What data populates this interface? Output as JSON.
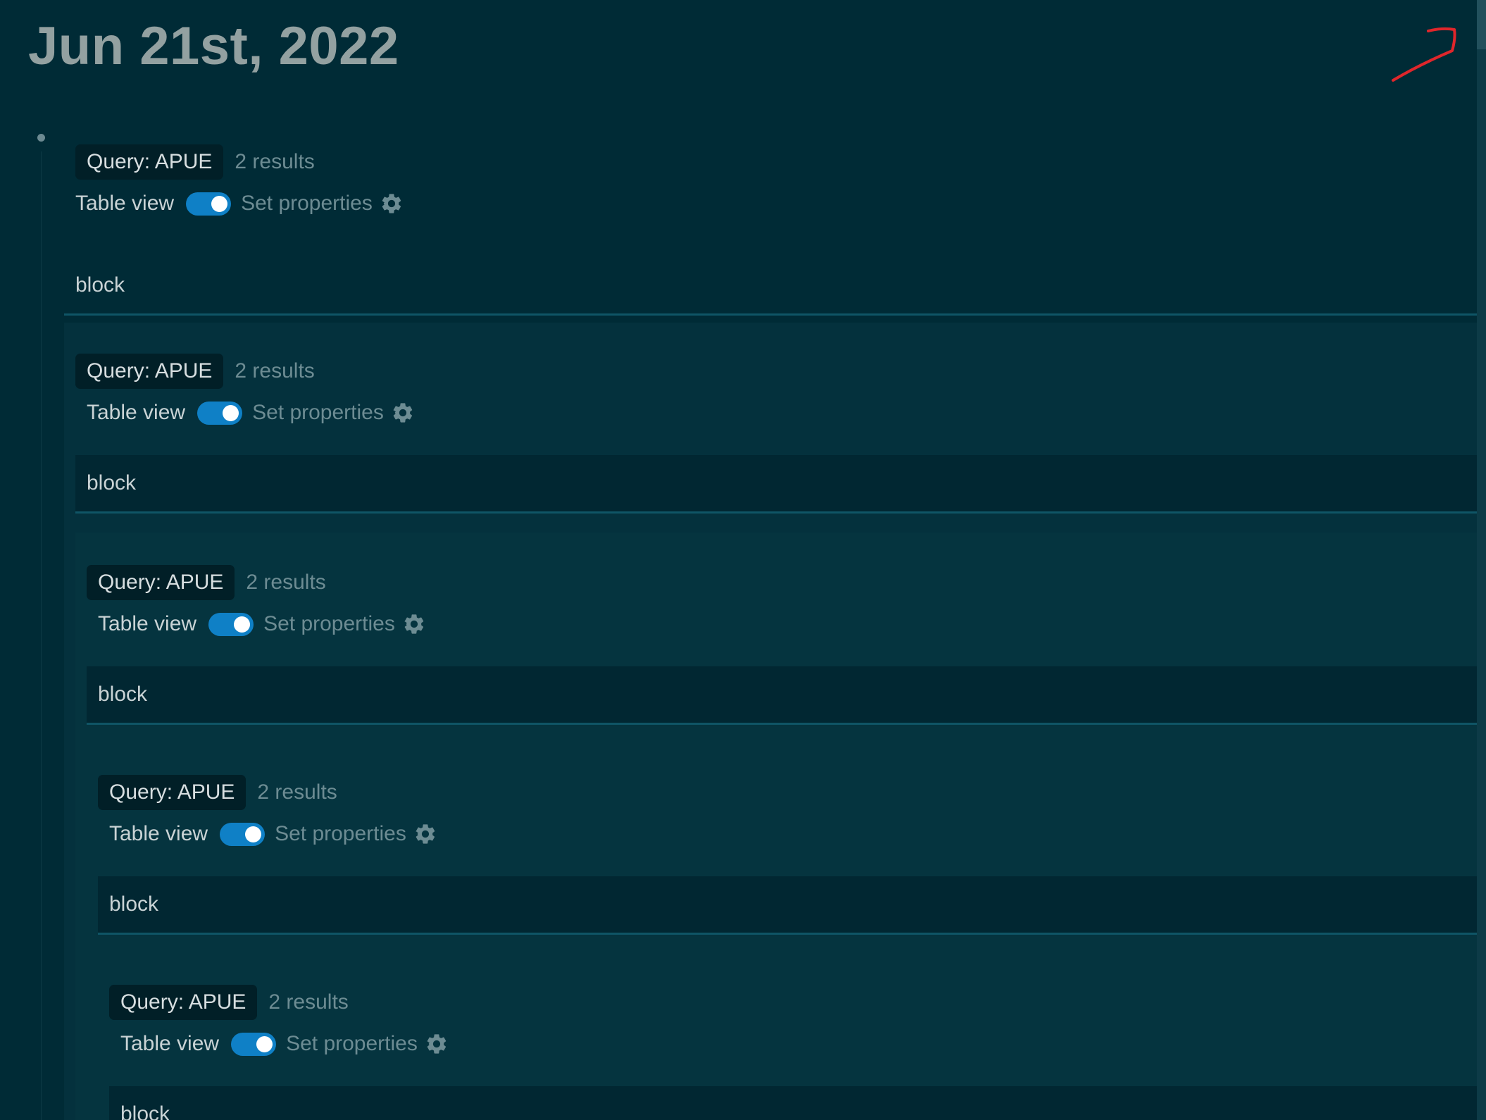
{
  "page": {
    "title": "Jun 21st, 2022"
  },
  "queries": [
    {
      "title": "Query: APUE",
      "results_count": "2 results",
      "table_view_label": "Table view",
      "table_view_on": true,
      "set_properties_label": "Set properties",
      "rows": [
        "block"
      ]
    },
    {
      "title": "Query: APUE",
      "results_count": "2 results",
      "table_view_label": "Table view",
      "table_view_on": true,
      "set_properties_label": "Set properties",
      "rows": [
        "block"
      ]
    },
    {
      "title": "Query: APUE",
      "results_count": "2 results",
      "table_view_label": "Table view",
      "table_view_on": true,
      "set_properties_label": "Set properties",
      "rows": [
        "block"
      ]
    },
    {
      "title": "Query: APUE",
      "results_count": "2 results",
      "table_view_label": "Table view",
      "table_view_on": true,
      "set_properties_label": "Set properties",
      "rows": [
        "block"
      ]
    },
    {
      "title": "Query: APUE",
      "results_count": "2 results",
      "table_view_label": "Table view",
      "table_view_on": true,
      "set_properties_label": "Set properties",
      "rows": [
        "block"
      ]
    }
  ],
  "icons": {
    "gear": "gear-icon",
    "annotation": "red-arrow-icon"
  },
  "colors": {
    "background": "#002b36",
    "toggle_on": "#0f80c6",
    "annotation": "#e0262b"
  }
}
